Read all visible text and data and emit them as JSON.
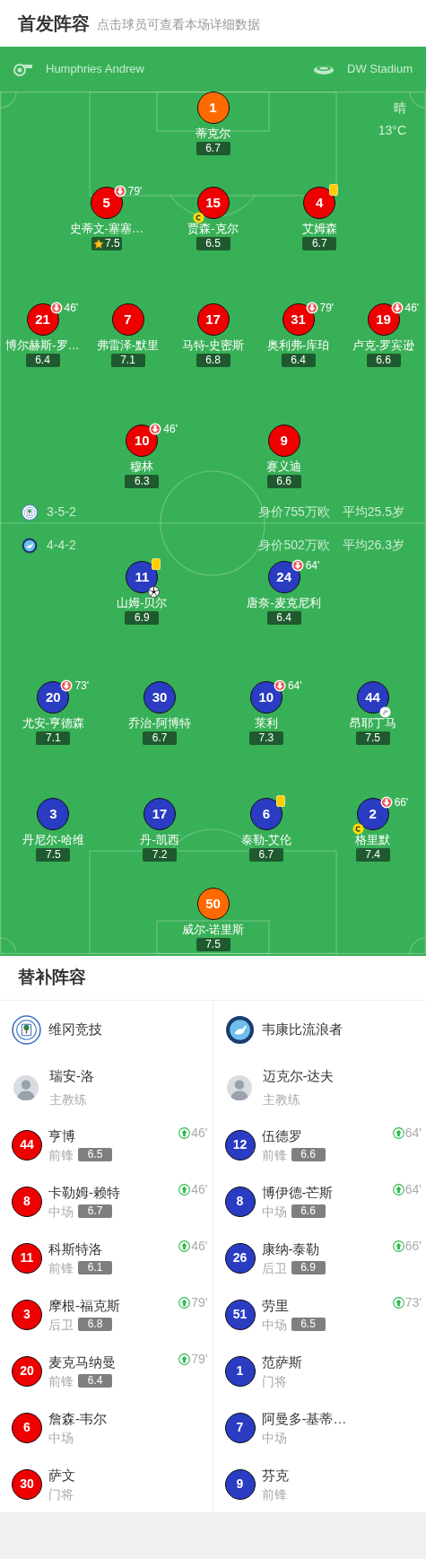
{
  "header": {
    "title": "首发阵容",
    "subtitle": "点击球员可查看本场详细数据"
  },
  "match_info": {
    "referee": "Humphries Andrew",
    "stadium": "DW Stadium",
    "weather": "晴",
    "temperature": "13°C"
  },
  "teams": [
    {
      "formation": "3-5-2",
      "market_value": "身价755万欧",
      "average_age": "平均25.5岁",
      "lines": [
        [
          {
            "number": "1",
            "name": "蒂克尔",
            "rating": "6.7",
            "color": "#ff6a00"
          }
        ],
        [
          {
            "number": "5",
            "name": "史蒂文-塞塞…",
            "rating": "7.5",
            "color": "#ee0000",
            "badges": [
              {
                "kind": "sub_out",
                "minute": "79'"
              },
              {
                "kind": "mvp"
              }
            ]
          },
          {
            "number": "15",
            "name": "贾森-克尔",
            "rating": "6.5",
            "color": "#ee0000",
            "badges": [
              {
                "kind": "captain"
              }
            ]
          },
          {
            "number": "4",
            "name": "艾姆森",
            "rating": "6.7",
            "color": "#ee0000",
            "badges": [
              {
                "kind": "yellow_card"
              }
            ]
          }
        ],
        [
          {
            "number": "21",
            "name": "博尔赫斯-罗…",
            "rating": "6.4",
            "color": "#ee0000",
            "badges": [
              {
                "kind": "sub_out",
                "minute": "46'"
              }
            ]
          },
          {
            "number": "7",
            "name": "弗雷泽-默里",
            "rating": "7.1",
            "color": "#ee0000"
          },
          {
            "number": "17",
            "name": "马特-史密斯",
            "rating": "6.8",
            "color": "#ee0000"
          },
          {
            "number": "31",
            "name": "奥利弗-库珀",
            "rating": "6.4",
            "color": "#ee0000",
            "badges": [
              {
                "kind": "sub_out",
                "minute": "79'"
              }
            ]
          },
          {
            "number": "19",
            "name": "卢克-罗宾逊",
            "rating": "6.6",
            "color": "#ee0000",
            "badges": [
              {
                "kind": "sub_out",
                "minute": "46'"
              }
            ]
          }
        ],
        [
          {
            "number": "10",
            "name": "穆林",
            "rating": "6.3",
            "color": "#ee0000",
            "badges": [
              {
                "kind": "sub_out",
                "minute": "46'"
              }
            ]
          },
          {
            "number": "9",
            "name": "赛义迪",
            "rating": "6.6",
            "color": "#ee0000"
          }
        ]
      ]
    },
    {
      "formation": "4-4-2",
      "market_value": "身价502万欧",
      "average_age": "平均26.3岁",
      "lines": [
        [
          {
            "number": "11",
            "name": "山姆-贝尔",
            "rating": "6.9",
            "color": "#2a3cc2",
            "badges": [
              {
                "kind": "yellow_card"
              },
              {
                "kind": "goal"
              }
            ]
          },
          {
            "number": "24",
            "name": "唐奈-麦克尼利",
            "rating": "6.4",
            "color": "#2a3cc2",
            "badges": [
              {
                "kind": "sub_out",
                "minute": "64'"
              }
            ]
          }
        ],
        [
          {
            "number": "20",
            "name": "尤安-亨德森",
            "rating": "7.1",
            "color": "#2a3cc2",
            "badges": [
              {
                "kind": "sub_out",
                "minute": "73'"
              }
            ]
          },
          {
            "number": "30",
            "name": "乔治-阿博特",
            "rating": "6.7",
            "color": "#2a3cc2"
          },
          {
            "number": "10",
            "name": "莱利",
            "rating": "7.3",
            "color": "#2a3cc2",
            "badges": [
              {
                "kind": "sub_out",
                "minute": "64'"
              }
            ]
          },
          {
            "number": "44",
            "name": "昂耶丁马",
            "rating": "7.5",
            "color": "#2a3cc2",
            "badges": [
              {
                "kind": "assist"
              }
            ]
          }
        ],
        [
          {
            "number": "3",
            "name": "丹尼尔-哈维",
            "rating": "7.5",
            "color": "#2a3cc2"
          },
          {
            "number": "17",
            "name": "丹-凯西",
            "rating": "7.2",
            "color": "#2a3cc2"
          },
          {
            "number": "6",
            "name": "泰勒-艾伦",
            "rating": "6.7",
            "color": "#2a3cc2",
            "badges": [
              {
                "kind": "yellow_card"
              }
            ]
          },
          {
            "number": "2",
            "name": "格里默",
            "rating": "7.4",
            "color": "#2a3cc2",
            "badges": [
              {
                "kind": "captain"
              },
              {
                "kind": "sub_out",
                "minute": "66'"
              }
            ]
          }
        ],
        [
          {
            "number": "50",
            "name": "威尔-诺里斯",
            "rating": "7.5",
            "color": "#ff6a00"
          }
        ]
      ]
    }
  ],
  "bench": {
    "title": "替补阵容",
    "teams": [
      {
        "name": "维冈竞技",
        "color": "#ee0000",
        "coach": {
          "name": "瑞安-洛",
          "role": "主教练"
        },
        "subs": [
          {
            "number": "44",
            "name": "亨博",
            "position": "前锋",
            "rating": "6.5",
            "sub_in": "46'"
          },
          {
            "number": "8",
            "name": "卡勒姆-赖特",
            "position": "中场",
            "rating": "6.7",
            "sub_in": "46'"
          },
          {
            "number": "11",
            "name": "科斯特洛",
            "position": "前锋",
            "rating": "6.1",
            "sub_in": "46'"
          },
          {
            "number": "3",
            "name": "摩根-福克斯",
            "position": "后卫",
            "rating": "6.8",
            "sub_in": "79'"
          },
          {
            "number": "20",
            "name": "麦克马纳曼",
            "position": "前锋",
            "rating": "6.4",
            "sub_in": "79'"
          },
          {
            "number": "6",
            "name": "詹森-韦尔",
            "position": "中场"
          },
          {
            "number": "30",
            "name": "萨文",
            "position": "门将"
          }
        ]
      },
      {
        "name": "韦康比流浪者",
        "color": "#2a3cc2",
        "coach": {
          "name": "迈克尔-达夫",
          "role": "主教练"
        },
        "subs": [
          {
            "number": "12",
            "name": "伍德罗",
            "position": "前锋",
            "rating": "6.6",
            "sub_in": "64'"
          },
          {
            "number": "8",
            "name": "博伊德-芒斯",
            "position": "中场",
            "rating": "6.6",
            "sub_in": "64'"
          },
          {
            "number": "26",
            "name": "康纳-泰勒",
            "position": "后卫",
            "rating": "6.9",
            "sub_in": "66'"
          },
          {
            "number": "51",
            "name": "劳里",
            "position": "中场",
            "rating": "6.5",
            "sub_in": "73'"
          },
          {
            "number": "1",
            "name": "范萨斯",
            "position": "门将"
          },
          {
            "number": "7",
            "name": "阿曼多-基蒂…",
            "position": "中场"
          },
          {
            "number": "9",
            "name": "芬克",
            "position": "前锋"
          }
        ]
      }
    ]
  }
}
